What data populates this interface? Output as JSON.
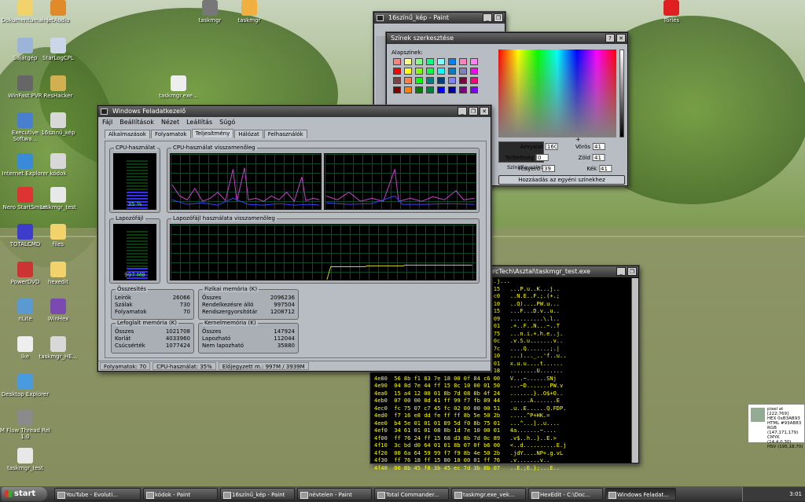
{
  "desktop_icons": [
    {
      "label": "Dokumentumaim",
      "icon": "folder-icon",
      "color": "#f2d36b"
    },
    {
      "label": "jetAudio",
      "icon": "audio-icon",
      "color": "#e08a2a"
    },
    {
      "label": "Sajátgép",
      "icon": "computer-icon",
      "color": "#9bb4d8"
    },
    {
      "label": "StarLogCPL",
      "icon": "app-icon",
      "color": "#c9d7e8"
    },
    {
      "label": "WinFast PVR",
      "icon": "tv-icon",
      "color": "#666"
    },
    {
      "label": "ResHacker",
      "icon": "hammer-icon",
      "color": "#d0b050"
    },
    {
      "label": "Executive Softwa...",
      "icon": "app-icon",
      "color": "#4a7fd0"
    },
    {
      "label": "16színű_kép",
      "icon": "image-icon",
      "color": "#d8d8d8"
    },
    {
      "label": "Internet Explorer",
      "icon": "ie-icon",
      "color": "#3a8ad8"
    },
    {
      "label": "kódok",
      "icon": "image-icon",
      "color": "#d8d8d8"
    },
    {
      "label": "Nero StartSmart",
      "icon": "nero-icon",
      "color": "#d33"
    },
    {
      "label": "taskmgr_test",
      "icon": "exe-icon",
      "color": "#e8e8e8"
    },
    {
      "label": "TOTALCMD",
      "icon": "disk-icon",
      "color": "#3d3dcc"
    },
    {
      "label": "files",
      "icon": "folder-icon",
      "color": "#f2d36b"
    },
    {
      "label": "PowerDVD",
      "icon": "dvd-icon",
      "color": "#c33"
    },
    {
      "label": "hexedit",
      "icon": "folder-icon",
      "color": "#f2d36b"
    },
    {
      "label": "nLite",
      "icon": "nlite-icon",
      "color": "#5a9ad0"
    },
    {
      "label": "WinHex",
      "icon": "hex-icon",
      "color": "#7a4ab0"
    },
    {
      "label": "lke",
      "icon": "document-icon",
      "color": "#eee"
    },
    {
      "label": "taskmgr_HE...",
      "icon": "image-icon",
      "color": "#d8d8d8"
    },
    {
      "label": "Desktop Explorer",
      "icon": "globe-icon",
      "color": "#4a9ae0"
    },
    {
      "label": "M Flow Thread Rel 1.0",
      "icon": "app-icon",
      "color": "#8a8a8a"
    },
    {
      "label": "taskmgr_test",
      "icon": "exe-icon",
      "color": "#e8e8e8"
    },
    {
      "label": "taskmgr",
      "icon": "monitor-icon",
      "color": "#777"
    },
    {
      "label": "taskmgr",
      "icon": "package-icon",
      "color": "#f0b040"
    },
    {
      "label": "taskmgr.exe...",
      "icon": "document-icon",
      "color": "#eee"
    },
    {
      "label": "Törlés",
      "icon": "delete-icon",
      "color": "#e02020"
    }
  ],
  "taskmgr": {
    "title": "Windows Feladatkezelő",
    "menu": [
      "Fájl",
      "Beállítások",
      "Nézet",
      "Leállítás",
      "Súgó"
    ],
    "tabs": [
      "Alkalmazások",
      "Folyamatok",
      "Teljesítmény",
      "Hálózat",
      "Felhasználók"
    ],
    "active_tab": "Teljesítmény",
    "cpu_label": "CPU-használat",
    "cpu_value": "35 %",
    "cpu_percent": 35,
    "cpu_hist_label": "CPU-használat visszamenőleg",
    "pf_label": "Lapozófájl",
    "pf_value": "997 MB",
    "pf_hist_label": "Lapozófájl használata visszamenőleg",
    "totals": {
      "title": "Összesítés",
      "rows": [
        [
          "Leírók",
          "26066"
        ],
        [
          "Szálak",
          "730"
        ],
        [
          "Folyamatok",
          "70"
        ]
      ]
    },
    "physical": {
      "title": "Fizikai memória (K)",
      "rows": [
        [
          "Összes",
          "2096236"
        ],
        [
          "Rendelkezésre álló",
          "997504"
        ],
        [
          "Rendszergyorsítótár",
          "1208712"
        ]
      ]
    },
    "commit": {
      "title": "Lefoglalt memória (K)",
      "rows": [
        [
          "Összes",
          "1021708"
        ],
        [
          "Korlát",
          "4033960"
        ],
        [
          "Csúcsérték",
          "1077424"
        ]
      ]
    },
    "kernel": {
      "title": "Kernelmemória (K)",
      "rows": [
        [
          "Összes",
          "147924"
        ],
        [
          "Lapozható",
          "112044"
        ],
        [
          "Nem lapozható",
          "35880"
        ]
      ]
    },
    "status": [
      "Folyamatok: 70",
      "CPU-használat: 35%",
      "Előjegyzett m.: 997M / 3939M"
    ]
  },
  "paint": {
    "title": "16színű_kép - Paint"
  },
  "color_dialog": {
    "title": "Színek szerkesztése",
    "basic_label": "Alapszínek:",
    "solid_label": "Színi|Egyszínű",
    "fields": [
      [
        "Árnyalat",
        "160"
      ],
      [
        "Vörös",
        "41"
      ],
      [
        "Telítettség",
        "0"
      ],
      [
        "Zöld",
        "41"
      ],
      [
        "Fényerő",
        "39"
      ],
      [
        "Kék",
        "41"
      ]
    ],
    "add_button": "Hozzáadás az egyéni színekhez",
    "basic_colors": [
      "#ff8080",
      "#ffff80",
      "#80ff80",
      "#00ff80",
      "#80ffff",
      "#0080ff",
      "#ff80c0",
      "#ff80ff",
      "#ff0000",
      "#ffff00",
      "#80ff00",
      "#00ff40",
      "#00ffff",
      "#0080c0",
      "#8080c0",
      "#ff00ff",
      "#804040",
      "#ff8040",
      "#00ff00",
      "#008080",
      "#004080",
      "#8080ff",
      "#800040",
      "#ff0080",
      "#800000",
      "#ff8000",
      "#008000",
      "#008040",
      "#0000ff",
      "#0000a0",
      "#800080",
      "#8000ff"
    ]
  },
  "hexwin": {
    "title": "ercTech\\Asztal\\taskmgr_test.exe",
    "lines": [
      "                          ~.+).1}]]].j...",
      "                  0c 6a 01 6a 00 ff 15   ...P.u..K...j..",
      "                  50 04 0a 0b 5b 2b c0   ..N.E..F.;.(+.;",
      "                  ff 75 08 ff 15 00 10   ..Q)....PW.u...",
      "                  76 08 ff 75 08 ff 15   ...F...D.v..u..",
      "                  63 4a 8b 74 45 08 09   ..........\\.l..",
      "                  0f 18 30 6a 00 00 01   .+..F..N...~..T",
      "                  01 eb 1f 6a 00 ff 75   ...n.i.+.h.e..j.",
      "                  80 10 00 01 ff 76 0c   .v.S.u.......v..",
      "                  01 83 eb 0c 3b f7 7c   ....Q.......;.|",
      "                  ec ff 75 0c ff 75 10   ...)..._..'f..u..",
      "                  e8 15 94 10 00 01 01   x.u.u....t......",
      "                  55 58 8b ec 83 ec 18   ........U.......",
      "4e80  56 8b f1 83 7e 18 00 0f 84 c6 00   V...~......SNj",
      "4e90  04 8d 7e 44 ff 15 8c 10 00 01 50   ...~D.......PW.v",
      "4ea0  15 a4 12 00 01 8b 7d 08 8b 4f 24   .......}..O$+O..",
      "4eb0  07 00 00 8d 41 ff 99 f7 fb 89 44   ......A.......E",
      "4ec0  fc 75 07 c7 45 fc 02 00 00 00 51   .u..E......Q.FDP.",
      "4ed0  f7 16 e8 dd fe ff ff 8b 5e 50 2b   .....^P+HK.=",
      "4ee0  b4 5e 01 01 01 89 5d f0 8b 75 01   ...^...]..u....",
      "4ef0  34 61 01 01 08 8b 1d 7e 10 00 01   4a.......~....",
      "4f00  ff 76 24 ff 15 68 d3 8b 7d 0c 89   .v$..h..}..E.>",
      "4f10  3c bd d0 64 01 01 8b 07 0f b6 00   <..d..........E.j",
      "4f20  00 6a 64 59 99 f7 f9 8b 4e 50 2b   .jdY....NP+.g.vL",
      "4f30  ff 76 18 ff 15 80 10 00 01 ff 76   .v.......v..",
      "4f40  00 8b 45 f8 3b 45 ec 7d 3b 8b 07   ..E.;E.};...E.."
    ]
  },
  "pixel_widget": {
    "rows": [
      "pixel at [222;769]",
      "HEX 0xB3AB93",
      "HTML #93AB83",
      "RGB (147,171,179)",
      "CMYK (14,4,0,30)",
      "HSV (195,18,70)"
    ],
    "swatch": "#93ab93"
  },
  "taskbar": {
    "start": "start",
    "buttons": [
      "YouTube - Evoluti...",
      "kódok - Paint",
      "16színű_kép - Paint",
      "névtelen - Paint",
      "Total Commander...",
      "taskmgr.exe_vek...",
      "HexEdit - C:\\Doc...",
      "Windows Feladat..."
    ],
    "active": "Windows Feladat...",
    "clock": "3:01"
  }
}
